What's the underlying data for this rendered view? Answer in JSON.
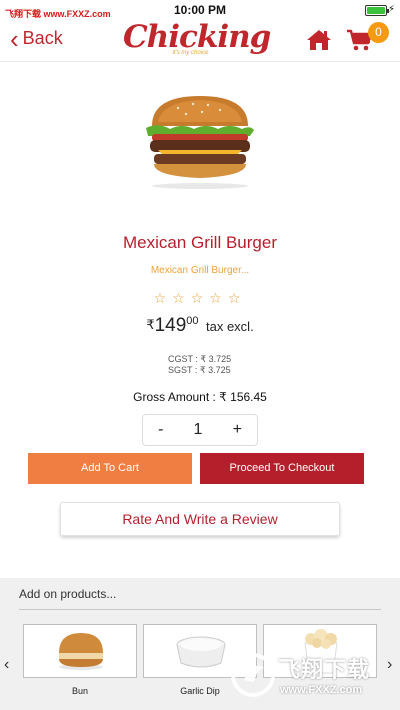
{
  "status_bar": {
    "watermark_text": "飞翔下载 www.FXXZ.com",
    "time": "10:00 PM",
    "battery_level": 1.0
  },
  "header": {
    "back_label": "Back",
    "logo_text": "Chicking",
    "logo_tagline": "it's my choice",
    "cart_count": "0",
    "brand_color": "#c0272d",
    "badge_color": "#f39c12"
  },
  "product": {
    "name": "Mexican Grill Burger",
    "description": "Mexican Grill Burger...",
    "rating": 0,
    "rating_max": 5,
    "currency_symbol": "₹",
    "price_whole": "149",
    "price_decimals": "00",
    "tax_note": "tax excl.",
    "cgst": "CGST : ₹ 3.725",
    "sgst": "SGST : ₹ 3.725",
    "gross_amount": "Gross Amount :  ₹ 156.45"
  },
  "quantity": {
    "minus": "-",
    "value": "1",
    "plus": "+"
  },
  "actions": {
    "add_to_cart": "Add To Cart",
    "checkout": "Proceed To Checkout",
    "review": "Rate And Write a Review",
    "add_color": "#f07e43",
    "checkout_color": "#b51f2b"
  },
  "addons": {
    "title": "Add on products...",
    "items": [
      {
        "label": "Bun",
        "icon": "bun-icon"
      },
      {
        "label": "Garlic Dip",
        "icon": "garlic-dip-icon"
      },
      {
        "label": "",
        "icon": "popcorn-icon"
      }
    ]
  },
  "watermark": {
    "text": "飞翔下载",
    "url": "www.FXXZ.com"
  }
}
